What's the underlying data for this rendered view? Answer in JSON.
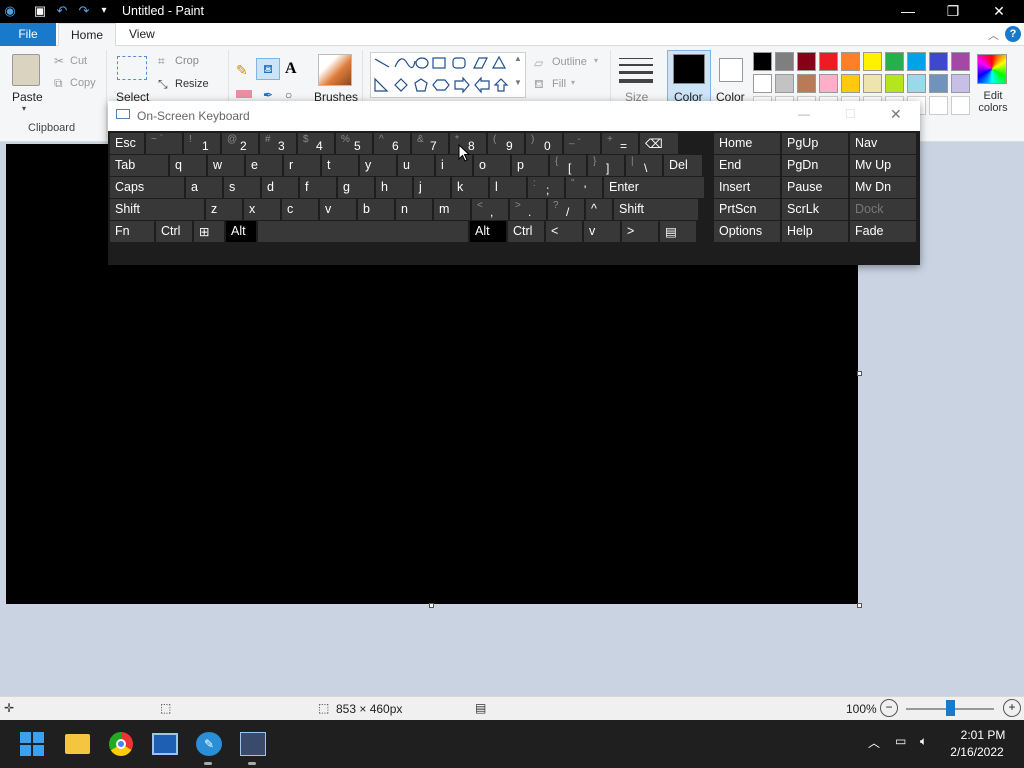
{
  "window": {
    "title": "Untitled - Paint"
  },
  "tabs": {
    "file": "File",
    "home": "Home",
    "view": "View"
  },
  "ribbon": {
    "clipboard": {
      "paste": "Paste",
      "cut": "Cut",
      "copy": "Copy",
      "group": "Clipboard"
    },
    "image": {
      "select": "Select",
      "crop": "Crop",
      "resize": "Resize"
    },
    "brushes": "Brushes",
    "shapes": {
      "outline": "Outline",
      "fill": "Fill"
    },
    "size": "Size",
    "color1": "Color",
    "color2": "Color",
    "edit_colors": "Edit colors",
    "palette": [
      "#000000",
      "#7f7f7f",
      "#880015",
      "#ed1c24",
      "#ff7f27",
      "#fff200",
      "#22b14c",
      "#00a2e8",
      "#3f48cc",
      "#a349a4",
      "#ffffff",
      "#c3c3c3",
      "#b97a57",
      "#ffaec9",
      "#ffc90e",
      "#efe4b0",
      "#b5e61d",
      "#99d9ea",
      "#7092be",
      "#c8bfe7"
    ]
  },
  "osk": {
    "title": "On-Screen Keyboard",
    "rows": [
      [
        {
          "l": "Esc"
        },
        {
          "s": "~ `"
        },
        {
          "s": "!",
          "l": "1"
        },
        {
          "s": "@",
          "l": "2"
        },
        {
          "s": "#",
          "l": "3"
        },
        {
          "s": "$",
          "l": "4"
        },
        {
          "s": "%",
          "l": "5"
        },
        {
          "s": "^",
          "l": "6"
        },
        {
          "s": "&",
          "l": "7"
        },
        {
          "s": "*",
          "l": "8"
        },
        {
          "s": "(",
          "l": "9"
        },
        {
          "s": ")",
          "l": "0"
        },
        {
          "s": "_ -"
        },
        {
          "s": "+",
          "l": "="
        },
        {
          "l": "⌫"
        }
      ],
      [
        {
          "l": "Tab"
        },
        {
          "l": "q"
        },
        {
          "l": "w"
        },
        {
          "l": "e"
        },
        {
          "l": "r"
        },
        {
          "l": "t"
        },
        {
          "l": "y"
        },
        {
          "l": "u"
        },
        {
          "l": "i"
        },
        {
          "l": "o"
        },
        {
          "l": "p"
        },
        {
          "s": "{",
          "l": "["
        },
        {
          "s": "}",
          "l": "]"
        },
        {
          "s": "|",
          "l": "\\"
        },
        {
          "l": "Del"
        }
      ],
      [
        {
          "l": "Caps"
        },
        {
          "l": "a"
        },
        {
          "l": "s"
        },
        {
          "l": "d"
        },
        {
          "l": "f"
        },
        {
          "l": "g"
        },
        {
          "l": "h"
        },
        {
          "l": "j"
        },
        {
          "l": "k"
        },
        {
          "l": "l"
        },
        {
          "s": ":",
          "l": ";"
        },
        {
          "s": "\"",
          "l": "'"
        },
        {
          "l": "Enter"
        }
      ],
      [
        {
          "l": "Shift"
        },
        {
          "l": "z"
        },
        {
          "l": "x"
        },
        {
          "l": "c"
        },
        {
          "l": "v"
        },
        {
          "l": "b"
        },
        {
          "l": "n"
        },
        {
          "l": "m"
        },
        {
          "s": "<",
          "l": ","
        },
        {
          "s": ">",
          "l": "."
        },
        {
          "s": "?",
          "l": "/"
        },
        {
          "l": "^"
        },
        {
          "l": "Shift"
        }
      ],
      [
        {
          "l": "Fn"
        },
        {
          "l": "Ctrl"
        },
        {
          "l": "⊞"
        },
        {
          "l": "Alt"
        },
        {
          "l": ""
        },
        {
          "l": "Alt"
        },
        {
          "l": "Ctrl"
        },
        {
          "l": "<"
        },
        {
          "l": "v"
        },
        {
          "l": ">"
        },
        {
          "l": "▤"
        }
      ]
    ],
    "nav": [
      [
        "Home",
        "PgUp",
        "Nav"
      ],
      [
        "End",
        "PgDn",
        "Mv Up"
      ],
      [
        "Insert",
        "Pause",
        "Mv Dn"
      ],
      [
        "PrtScn",
        "ScrLk",
        "Dock"
      ],
      [
        "Options",
        "Help",
        "Fade"
      ]
    ]
  },
  "status": {
    "size": "853 × 460px",
    "zoom": "100%"
  },
  "taskbar": {
    "time": "2:01 PM",
    "date": "2/16/2022"
  }
}
